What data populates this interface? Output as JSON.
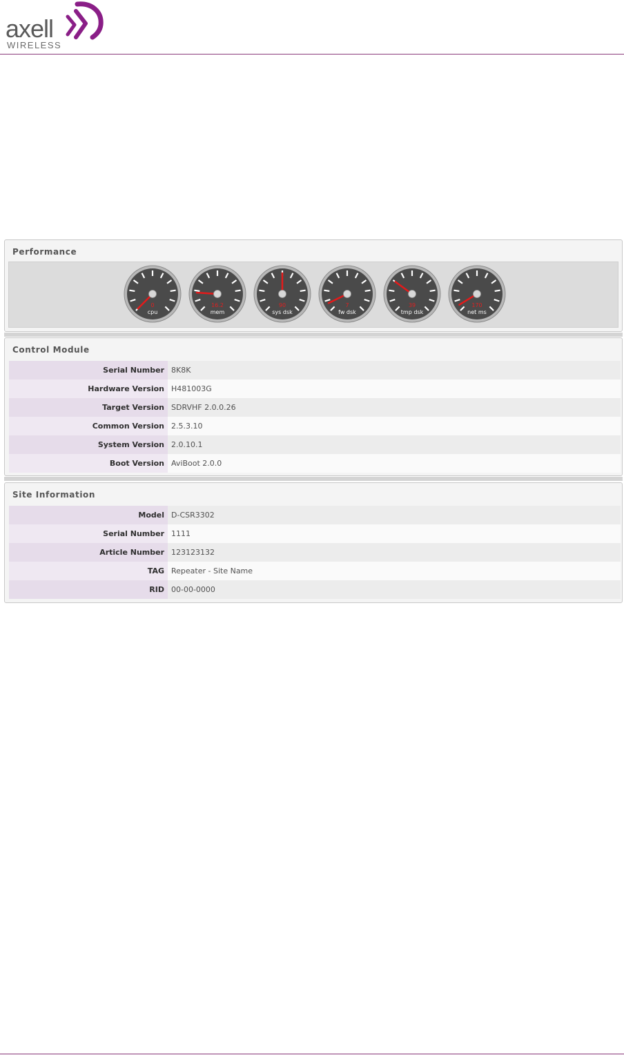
{
  "brand": {
    "name": "axell",
    "sub": "WIRELESS",
    "accent": "#8a1e87"
  },
  "performance": {
    "title": "Performance",
    "gauges": [
      {
        "label": "cpu",
        "value": "0",
        "fraction": 0.0
      },
      {
        "label": "mem",
        "value": "16.2",
        "fraction": 0.18
      },
      {
        "label": "sys dsk",
        "value": "90",
        "fraction": 0.5
      },
      {
        "label": "fw dsk",
        "value": "7",
        "fraction": 0.07
      },
      {
        "label": "tmp dsk",
        "value": "39",
        "fraction": 0.3
      },
      {
        "label": "net ms",
        "value": "170",
        "fraction": 0.05
      }
    ]
  },
  "control_module": {
    "title": "Control Module",
    "rows": [
      {
        "key": "Serial Number",
        "value": "8K8K"
      },
      {
        "key": "Hardware Version",
        "value": "H481003G"
      },
      {
        "key": "Target Version",
        "value": "SDRVHF 2.0.0.26"
      },
      {
        "key": "Common Version",
        "value": "2.5.3.10"
      },
      {
        "key": "System Version",
        "value": "2.0.10.1"
      },
      {
        "key": "Boot Version",
        "value": "AviBoot 2.0.0"
      }
    ]
  },
  "site_information": {
    "title": "Site Information",
    "rows": [
      {
        "key": "Model",
        "value": "D-CSR3302"
      },
      {
        "key": "Serial Number",
        "value": "1111"
      },
      {
        "key": "Article Number",
        "value": "123123132"
      },
      {
        "key": "TAG",
        "value": "Repeater - Site Name"
      },
      {
        "key": "RID",
        "value": "00-00-0000"
      }
    ]
  }
}
